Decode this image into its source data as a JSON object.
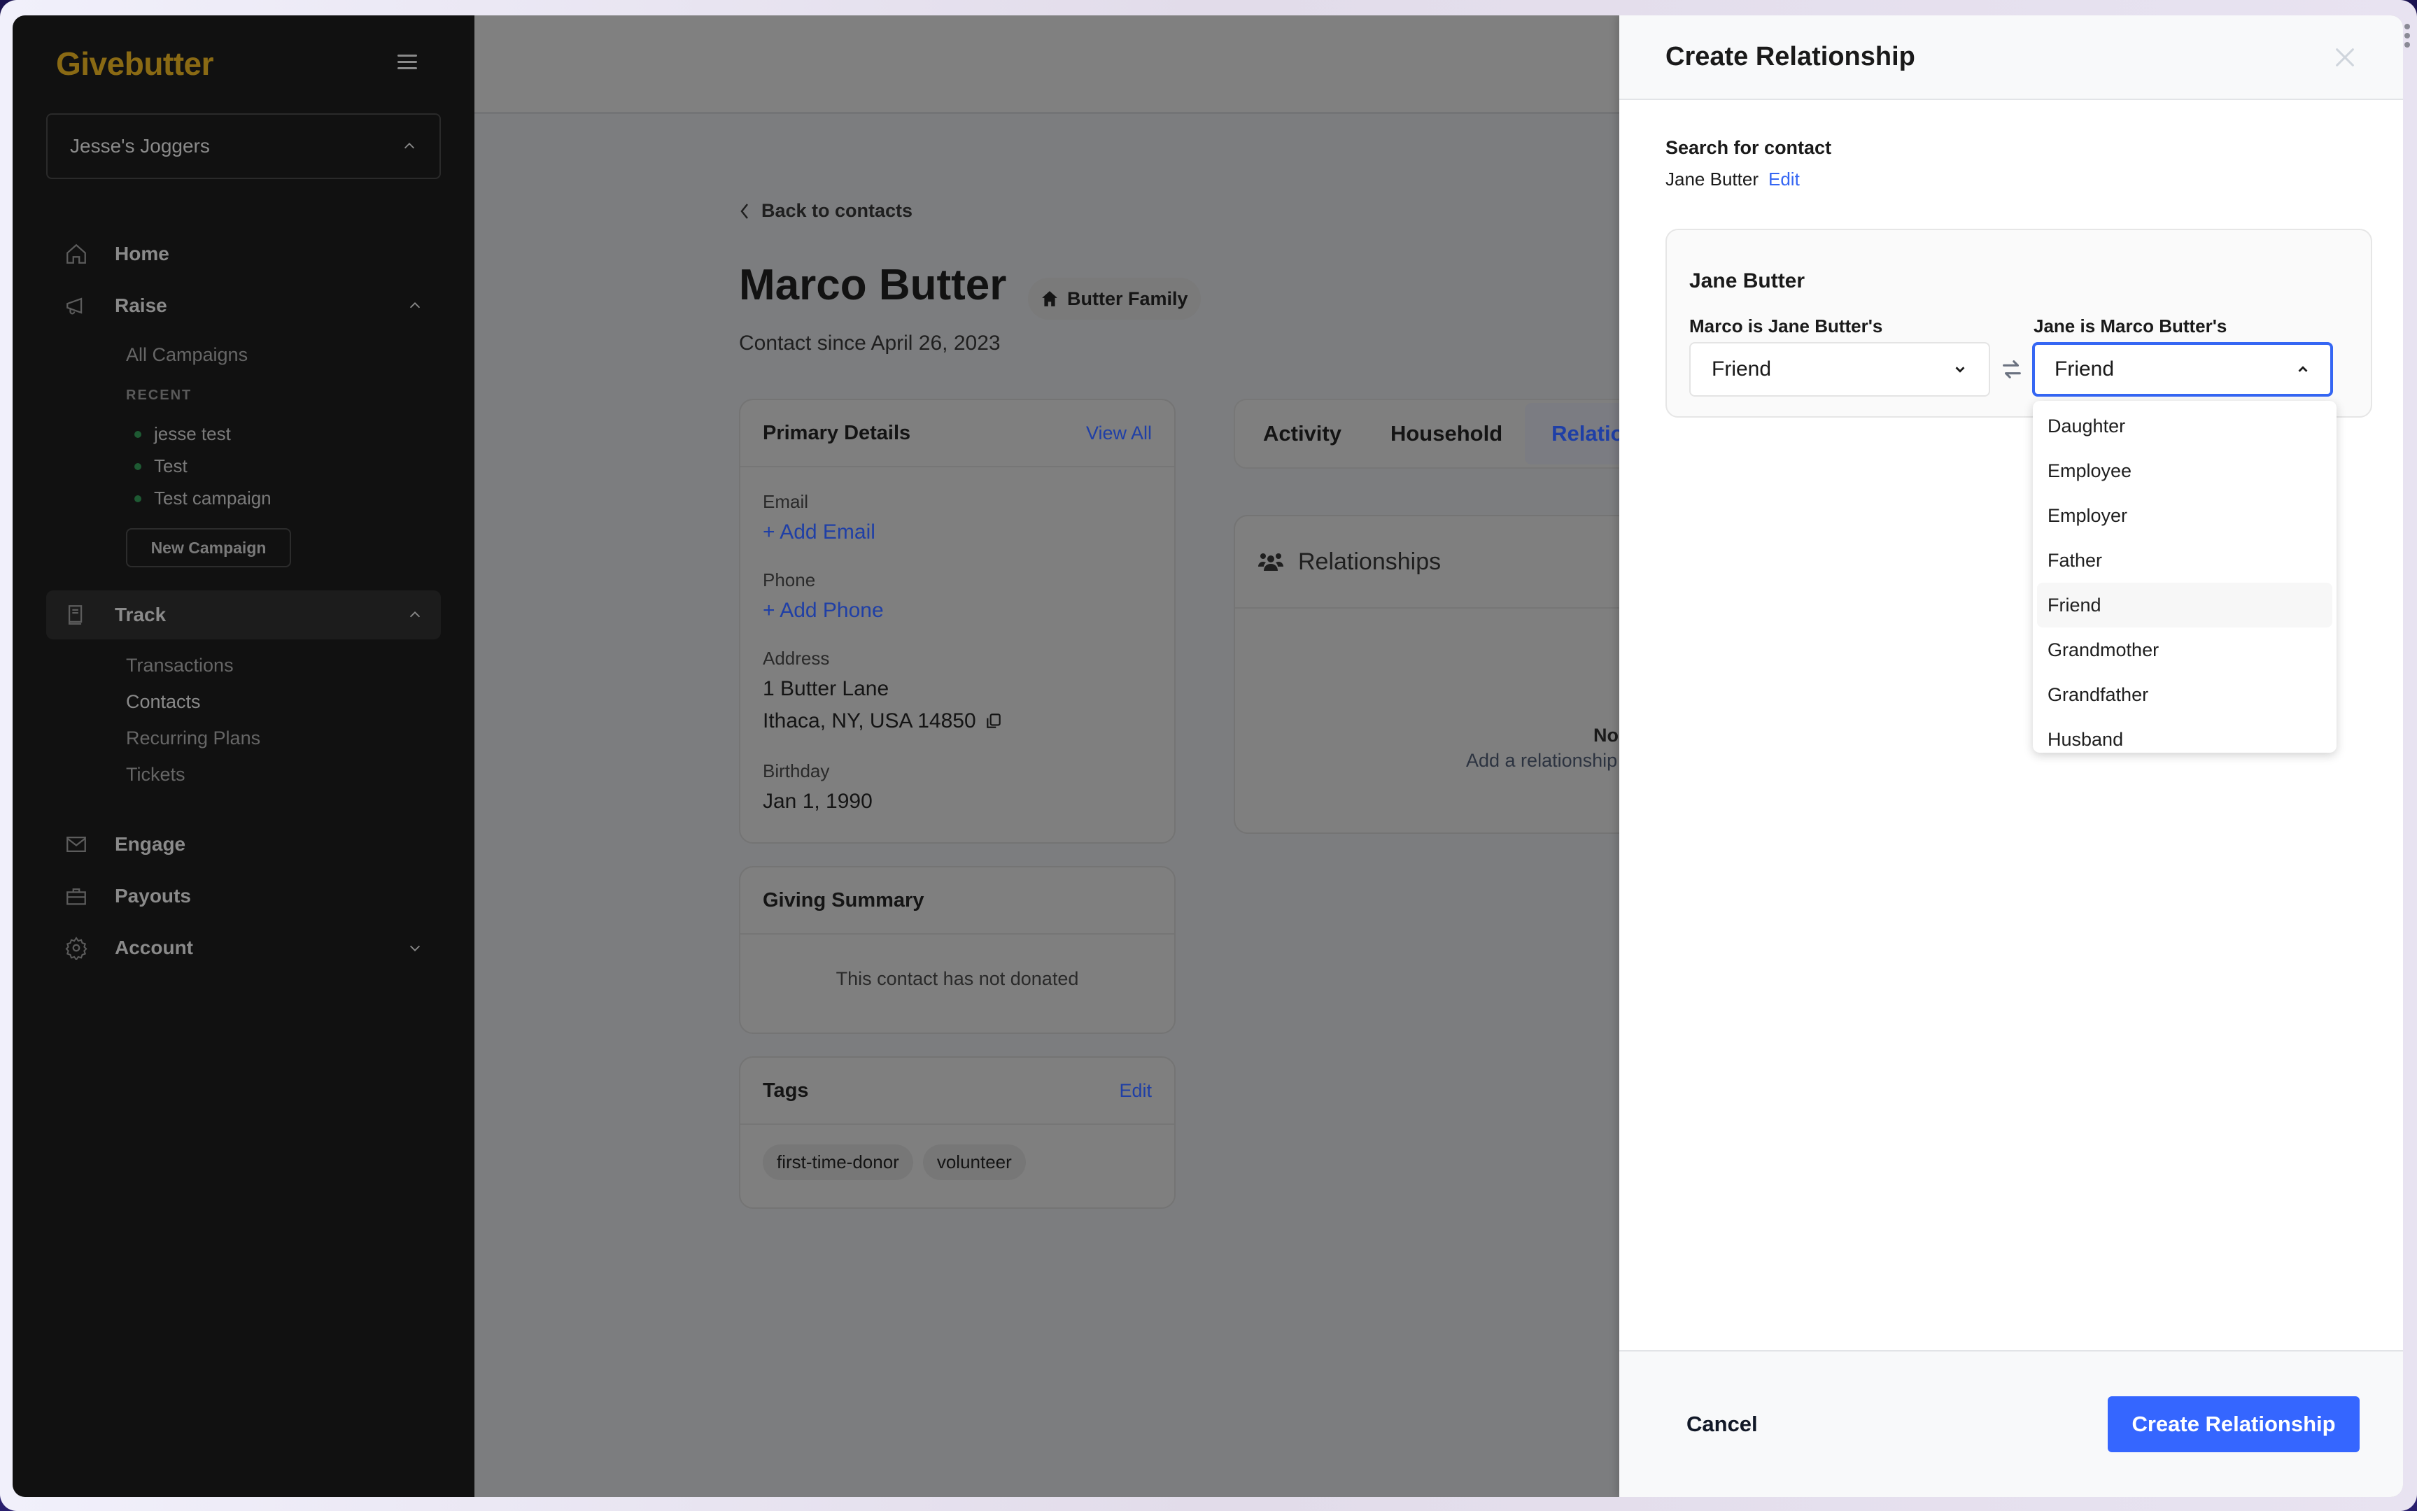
{
  "app": {
    "brand": "Givebutter",
    "brand_color": "#8a6a14",
    "accent_color": "#3566ff"
  },
  "sidebar": {
    "org_name": "Jesse's Joggers",
    "nav": {
      "home": "Home",
      "raise": "Raise",
      "track": "Track",
      "engage": "Engage",
      "payouts": "Payouts",
      "account": "Account"
    },
    "raise_sub": {
      "all_campaigns": "All Campaigns",
      "recent_heading": "RECENT",
      "recent": [
        "jesse test",
        "Test",
        "Test campaign"
      ],
      "new_campaign": "New Campaign"
    },
    "track_sub": [
      "Transactions",
      "Contacts",
      "Recurring Plans",
      "Tickets"
    ]
  },
  "contact": {
    "back_label": "Back to contacts",
    "name": "Marco Butter",
    "household": "Butter Family",
    "since": "Contact since April 26, 2023",
    "primary_details": {
      "title": "Primary Details",
      "view_all": "View All",
      "email_label": "Email",
      "add_email": "+ Add Email",
      "phone_label": "Phone",
      "add_phone": "+ Add Phone",
      "address_label": "Address",
      "address_line1": "1 Butter Lane",
      "address_line2": "Ithaca, NY, USA 14850",
      "birthday_label": "Birthday",
      "birthday": "Jan 1, 1990"
    },
    "giving_summary": {
      "title": "Giving Summary",
      "empty": "This contact has not donated"
    },
    "tags": {
      "title": "Tags",
      "edit": "Edit",
      "items": [
        "first-time-donor",
        "volunteer"
      ]
    },
    "tabs": [
      "Activity",
      "Household",
      "Relationships"
    ],
    "relationships": {
      "title": "Relationships",
      "empty_title": "No relationships",
      "empty_sub": "Add a relationship to"
    }
  },
  "modal": {
    "title": "Create Relationship",
    "search_label": "Search for contact",
    "selected_contact": "Jane Butter",
    "edit_label": "Edit",
    "card_name": "Jane Butter",
    "left_label": "Marco is Jane Butter's",
    "left_value": "Friend",
    "right_label": "Jane is Marco Butter's",
    "right_value": "Friend",
    "options": [
      "Daughter",
      "Employee",
      "Employer",
      "Father",
      "Friend",
      "Grandmother",
      "Grandfather",
      "Husband"
    ],
    "highlighted_option": "Friend",
    "cancel": "Cancel",
    "submit": "Create Relationship"
  }
}
